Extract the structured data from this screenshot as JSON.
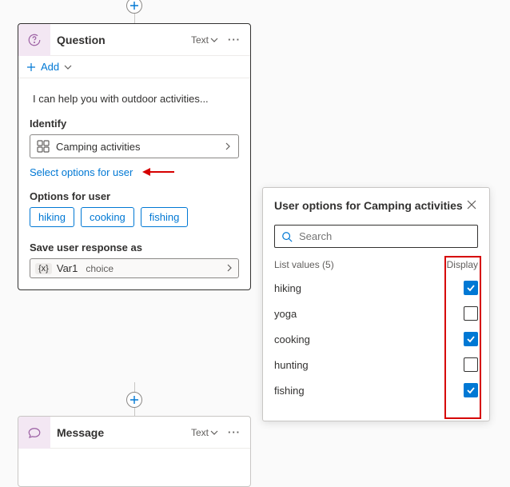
{
  "connectors": {},
  "questionCard": {
    "title": "Question",
    "typeLabel": "Text",
    "addLabel": "Add",
    "prompt": "I can help you with outdoor activities...",
    "identifyLabel": "Identify",
    "entityName": "Camping activities",
    "selectOptionsLink": "Select options for user",
    "optionsForUserLabel": "Options for user",
    "chips": [
      "hiking",
      "cooking",
      "fishing"
    ],
    "saveResponseLabel": "Save user response as",
    "varName": "Var1",
    "varType": "choice"
  },
  "messageCard": {
    "title": "Message",
    "typeLabel": "Text"
  },
  "panel": {
    "title": "User options for Camping activities",
    "searchPlaceholder": "Search",
    "listValuesLabel": "List values (5)",
    "displayLabel": "Display",
    "rows": [
      {
        "label": "hiking",
        "checked": true
      },
      {
        "label": "yoga",
        "checked": false
      },
      {
        "label": "cooking",
        "checked": true
      },
      {
        "label": "hunting",
        "checked": false
      },
      {
        "label": "fishing",
        "checked": true
      }
    ]
  }
}
